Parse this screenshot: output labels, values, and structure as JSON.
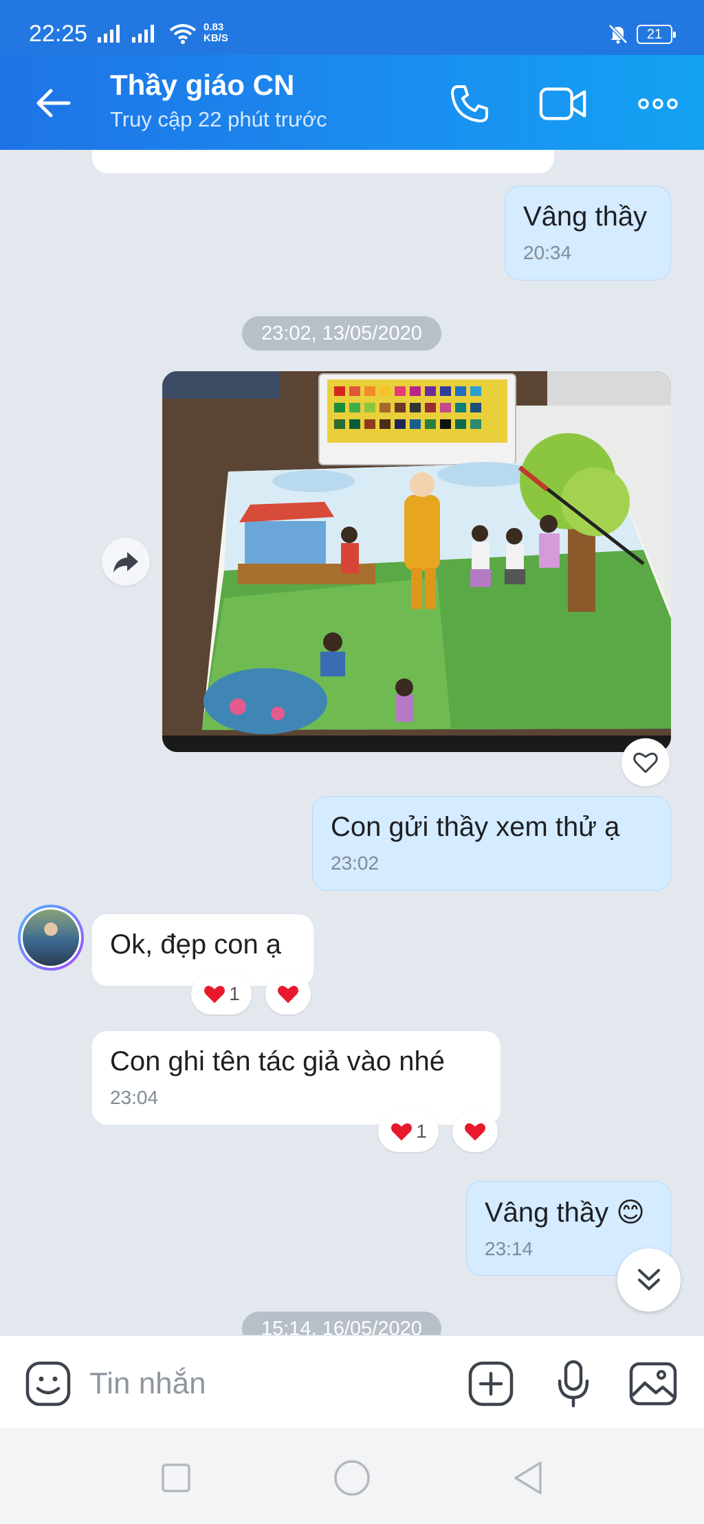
{
  "status_bar": {
    "time": "22:25",
    "speed_value": "0.83",
    "speed_unit": "KB/S",
    "battery": "21"
  },
  "header": {
    "title": "Thầy giáo CN",
    "subtitle": "Truy cập 22 phút trước"
  },
  "messages": [
    {
      "text": "Vâng thầy",
      "time": "20:34"
    },
    {
      "text": "Con gửi thầy xem thử ạ",
      "time": "23:02"
    },
    {
      "text": "Ok, đẹp con ạ"
    },
    {
      "text": "Con ghi tên tác giả vào nhé",
      "time": "23:04"
    },
    {
      "text": "Vâng thầy 😊",
      "time": "23:14"
    }
  ],
  "dates": [
    "23:02, 13/05/2020",
    "15:14, 16/05/2020"
  ],
  "reactions": {
    "msg3_count": "1",
    "msg4_count": "1"
  },
  "input": {
    "placeholder": "Tin nhắn"
  },
  "colors": {
    "header": "#1a8ff0",
    "outgoing_bubble": "#d5ebff",
    "incoming_bubble": "#ffffff",
    "background": "#e3e8ef",
    "heart": "#e8192c"
  }
}
